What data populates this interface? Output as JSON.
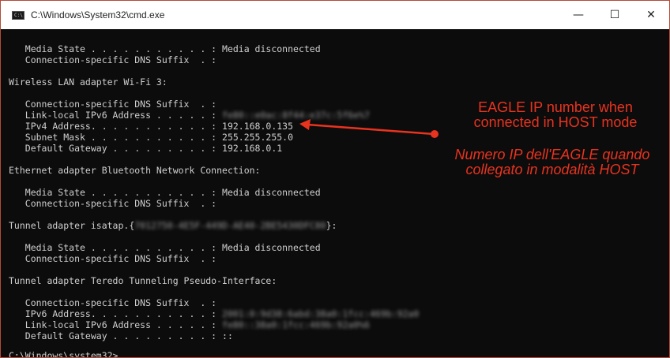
{
  "window": {
    "title": "C:\\Windows\\System32\\cmd.exe",
    "icon_label": "C:\\",
    "minimize_glyph": "—",
    "maximize_glyph": "☐",
    "close_glyph": "✕"
  },
  "console": {
    "lines": [
      {
        "text": "   Media State . . . . . . . . . . . : Media disconnected",
        "blur": ""
      },
      {
        "text": "   Connection-specific DNS Suffix  . :",
        "blur": ""
      },
      {
        "text": "Wireless LAN adapter Wi-Fi 3:",
        "blur": ""
      },
      {
        "text": "   Connection-specific DNS Suffix  . :",
        "blur": ""
      },
      {
        "text": "   Link-local IPv6 Address . . . . . : ",
        "blur": "fe80::e0ac:8f44:e37c:5f6e%7"
      },
      {
        "text": "   IPv4 Address. . . . . . . . . . . : 192.168.0.135",
        "blur": ""
      },
      {
        "text": "   Subnet Mask . . . . . . . . . . . : 255.255.255.0",
        "blur": ""
      },
      {
        "text": "   Default Gateway . . . . . . . . . : 192.168.0.1",
        "blur": ""
      },
      {
        "text": "Ethernet adapter Bluetooth Network Connection:",
        "blur": ""
      },
      {
        "text": "   Media State . . . . . . . . . . . : Media disconnected",
        "blur": ""
      },
      {
        "text": "   Connection-specific DNS Suffix  . :",
        "blur": ""
      },
      {
        "text": "Tunnel adapter isatap.{",
        "blur": "7012750-4E5F-449D-AE40-2BE5430DFC80",
        "suffix": "}:"
      },
      {
        "text": "   Media State . . . . . . . . . . . : Media disconnected",
        "blur": ""
      },
      {
        "text": "   Connection-specific DNS Suffix  . :",
        "blur": ""
      },
      {
        "text": "Tunnel adapter Teredo Tunneling Pseudo-Interface:",
        "blur": ""
      },
      {
        "text": "   Connection-specific DNS Suffix  . :",
        "blur": ""
      },
      {
        "text": "   IPv6 Address. . . . . . . . . . . : ",
        "blur": "2001:0:9d38:6abd:38a0:1fcc:469b:92a0"
      },
      {
        "text": "   Link-local IPv6 Address . . . . . : ",
        "blur": "fe80::38a0:1fcc:469b:92a0%6"
      },
      {
        "text": "   Default Gateway . . . . . . . . . : ::",
        "blur": ""
      },
      {
        "text": "C:\\Windows\\system32>_",
        "blur": ""
      }
    ]
  },
  "annotation": {
    "english": "EAGLE IP number when connected in HOST mode",
    "english_line1": "EAGLE IP number when",
    "english_line2": "connected in HOST mode",
    "italian_line1": "Numero IP dell'EAGLE quando",
    "italian_line2": "collegato in modalità HOST",
    "color": "#e8331f"
  }
}
